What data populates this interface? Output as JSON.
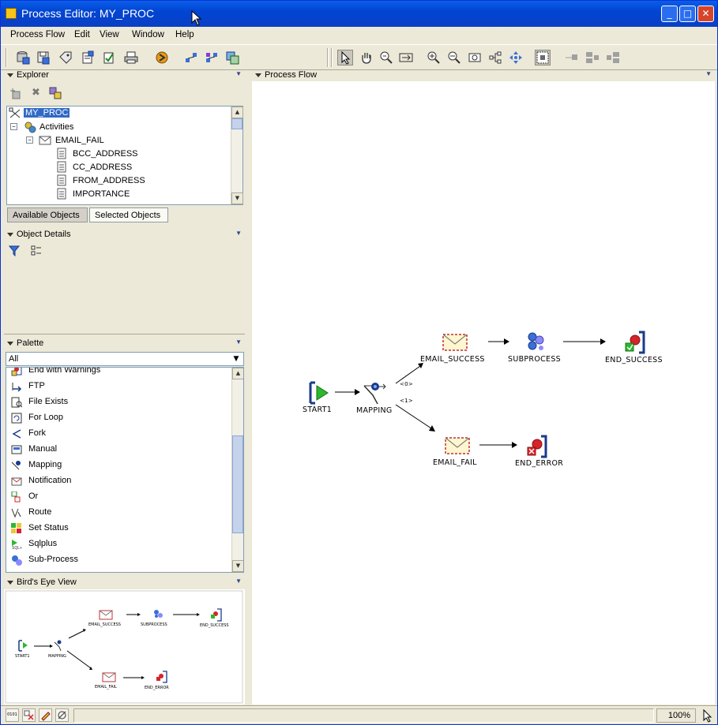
{
  "window": {
    "title": "Process Editor: MY_PROC"
  },
  "menu": [
    "Process Flow",
    "Edit",
    "View",
    "Window",
    "Help"
  ],
  "toolbar": {
    "left_icons": [
      "database-icon",
      "save-icon",
      "tag-icon",
      "properties-icon",
      "validate-icon",
      "print-icon",
      "deploy-icon",
      "auto-layout-icon",
      "expand-icon",
      "view-icon"
    ],
    "right_icons": [
      "select-pointer-icon",
      "pan-hand-icon",
      "zoom-area-icon",
      "fit-icon",
      "zoom-in-icon",
      "zoom-out-icon",
      "zoom-box-icon",
      "tree-layout-icon",
      "move-all-icon",
      "grid-toggle-icon",
      "align-left-icon",
      "align-center-icon",
      "align-right-icon"
    ]
  },
  "explorer": {
    "title": "Explorer",
    "tree": [
      {
        "label": "MY_PROC",
        "level": 0,
        "selected": true
      },
      {
        "label": "Activities",
        "level": 1
      },
      {
        "label": "EMAIL_FAIL",
        "level": 2
      },
      {
        "label": "BCC_ADDRESS",
        "level": 3
      },
      {
        "label": "CC_ADDRESS",
        "level": 3
      },
      {
        "label": "FROM_ADDRESS",
        "level": 3
      },
      {
        "label": "IMPORTANCE",
        "level": 3
      }
    ],
    "tabs": [
      "Available Objects",
      "Selected Objects"
    ]
  },
  "object_details": {
    "title": "Object Details"
  },
  "palette": {
    "title": "Palette",
    "filter": "All",
    "items": [
      "End with Warnings",
      "FTP",
      "File Exists",
      "For Loop",
      "Fork",
      "Manual",
      "Mapping",
      "Notification",
      "Or",
      "Route",
      "Set Status",
      "Sqlplus",
      "Sub-Process"
    ]
  },
  "birds_eye": {
    "title": "Bird's Eye View"
  },
  "process_flow": {
    "title": "Process Flow",
    "nodes": {
      "start": "START1",
      "mapping": "MAPPING",
      "email_success": "EMAIL_SUCCESS",
      "subprocess": "SUBPROCESS",
      "end_success": "END_SUCCESS",
      "email_fail": "EMAIL_FAIL",
      "end_error": "END_ERROR"
    },
    "edge_labels": {
      "success": "<0>",
      "fail": "<1>"
    }
  },
  "status": {
    "zoom": "100%"
  },
  "colors": {
    "title_bar": "#0a5ee8",
    "selection": "#316ac5",
    "start_green": "#2db82d",
    "end_red": "#d8232a"
  }
}
